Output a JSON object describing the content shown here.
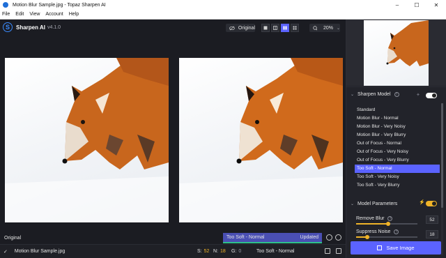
{
  "window": {
    "title": "Motion Blur Sample.jpg - Topaz Sharpen AI",
    "minimize": "–",
    "maximize": "☐",
    "close": "✕"
  },
  "menu": [
    "File",
    "Edit",
    "View",
    "Account",
    "Help"
  ],
  "app": {
    "name": "Sharpen AI",
    "version": "v4.1.0",
    "logo_letter": "S"
  },
  "toolbar": {
    "original_label": "Original",
    "zoom": "20%"
  },
  "preview": {
    "original_label": "Original",
    "model_label": "Too Soft - Normal",
    "status": "Updated"
  },
  "file": {
    "name": "Motion Blur Sample.jpg",
    "model": "Too Soft - Normal",
    "stats": [
      {
        "key": "S:",
        "value": "52"
      },
      {
        "key": "N:",
        "value": "18"
      },
      {
        "key": "G:",
        "value": "0"
      }
    ]
  },
  "sidebar": {
    "sharpen_model": {
      "title": "Sharpen Model",
      "items": [
        "Standard",
        "Motion Blur - Normal",
        "Motion Blur - Very Noisy",
        "Motion Blur - Very Blurry",
        "Out of Focus - Normal",
        "Out of Focus - Very Noisy",
        "Out of Focus - Very Blurry",
        "Too Soft - Normal",
        "Too Soft - Very Noisy",
        "Too Soft - Very Blurry"
      ],
      "selected_index": 7
    },
    "model_parameters": {
      "title": "Model Parameters",
      "params": [
        {
          "label": "Remove Blur",
          "value": "52",
          "fraction": 0.52
        },
        {
          "label": "Suppress Noise",
          "value": "18",
          "fraction": 0.18
        }
      ]
    },
    "save_label": "Save Image"
  },
  "colors": {
    "accent": "#5b63ff",
    "highlight": "#f0b429",
    "progress": "#2ec08a"
  }
}
